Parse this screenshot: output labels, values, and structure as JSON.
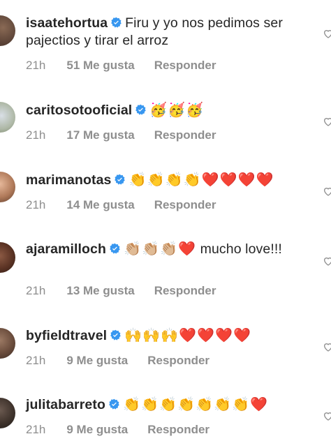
{
  "comments": [
    {
      "username": "isaatehortua",
      "text": "Firu y yo nos pedimos ser pajectios y tirar el arroz",
      "time": "21h",
      "likes": "51 Me gusta",
      "reply": "Responder",
      "verified": true,
      "emojis": []
    },
    {
      "username": "caritosotooficial",
      "text": "",
      "time": "21h",
      "likes": "17 Me gusta",
      "reply": "Responder",
      "verified": true,
      "emojis": [
        "🥳",
        "🥳",
        "🥳"
      ]
    },
    {
      "username": "marimanotas",
      "text": "",
      "time": "21h",
      "likes": "14 Me gusta",
      "reply": "Responder",
      "verified": true,
      "emojis": [
        "👏",
        "👏",
        "👏",
        "👏",
        "❤️",
        "❤️",
        "❤️",
        "❤️"
      ]
    },
    {
      "username": "ajaramilloch",
      "text": "mucho love!!!",
      "time": "21h",
      "likes": "13 Me gusta",
      "reply": "Responder",
      "verified": true,
      "emojis": [
        "👏🏼",
        "👏🏼",
        "👏🏼",
        "❤️"
      ]
    },
    {
      "username": "byfieldtravel",
      "text": "",
      "time": "21h",
      "likes": "9 Me gusta",
      "reply": "Responder",
      "verified": true,
      "emojis": [
        "🙌",
        "🙌",
        "🙌",
        "❤️",
        "❤️",
        "❤️",
        "❤️"
      ]
    },
    {
      "username": "julitabarreto",
      "text": "",
      "time": "21h",
      "likes": "9 Me gusta",
      "reply": "Responder",
      "verified": true,
      "emojis": [
        "👏",
        "👏",
        "👏",
        "👏",
        "👏",
        "👏",
        "👏",
        "❤️"
      ]
    }
  ],
  "colors": {
    "verified_badge": "#3897f0",
    "meta_text": "#8e8e8e",
    "username_text": "#262626",
    "heart": "#ed4956"
  }
}
